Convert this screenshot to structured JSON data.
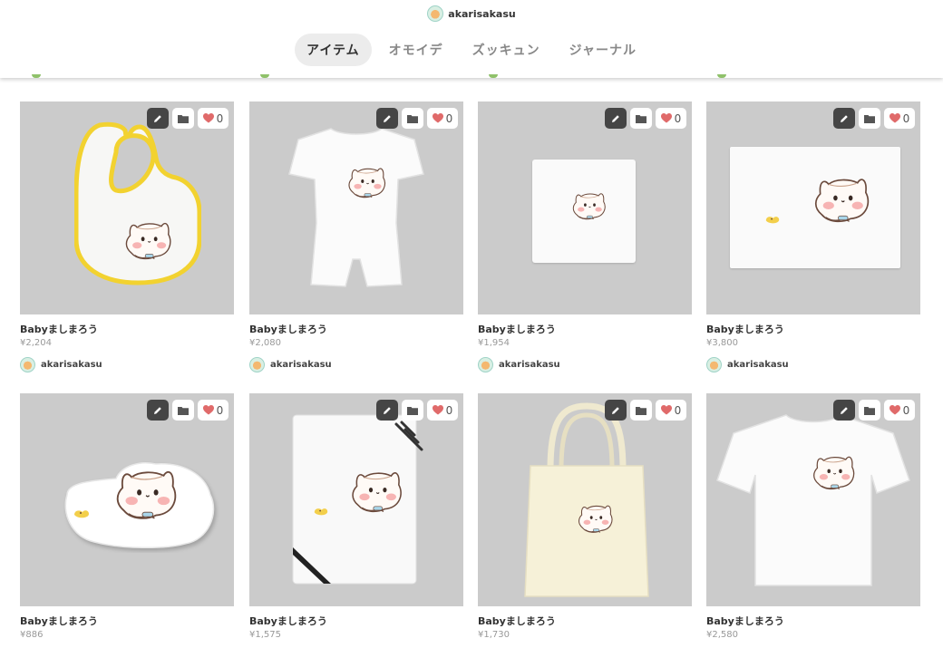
{
  "header": {
    "username": "akarisakasu",
    "tabs": [
      {
        "label": "アイテム",
        "active": true
      },
      {
        "label": "オモイデ",
        "active": false
      },
      {
        "label": "ズッキュン",
        "active": false
      },
      {
        "label": "ジャーナル",
        "active": false
      }
    ]
  },
  "items": [
    {
      "title": "Babyましまろう",
      "price": "¥2,204",
      "owner": "akarisakasu",
      "likes": "0",
      "product": "bib"
    },
    {
      "title": "Babyましまろう",
      "price": "¥2,080",
      "owner": "akarisakasu",
      "likes": "0",
      "product": "rompers"
    },
    {
      "title": "Babyましまろう",
      "price": "¥1,954",
      "owner": "akarisakasu",
      "likes": "0",
      "product": "hand-towel"
    },
    {
      "title": "Babyましまろう",
      "price": "¥3,800",
      "owner": "akarisakasu",
      "likes": "0",
      "product": "blanket"
    },
    {
      "title": "Babyましまろう",
      "price": "¥886",
      "owner": "akarisakasu",
      "likes": "0",
      "product": "sticker"
    },
    {
      "title": "Babyましまろう",
      "price": "¥1,575",
      "owner": "akarisakasu",
      "likes": "0",
      "product": "notebook"
    },
    {
      "title": "Babyましまろう",
      "price": "¥1,730",
      "owner": "akarisakasu",
      "likes": "0",
      "product": "tote-bag"
    },
    {
      "title": "Babyましまろう",
      "price": "¥2,580",
      "owner": "akarisakasu",
      "likes": "0",
      "product": "t-shirt"
    }
  ],
  "colors": {
    "thumb_bg": "#cbcbcb",
    "edit_button": "#454545",
    "heart": "#e06a6a",
    "active_tab_bg": "#ececec",
    "bib_trim": "#f2d230"
  },
  "icons": {
    "edit": "pencil-icon",
    "folder": "folder-icon",
    "like": "heart-icon"
  }
}
